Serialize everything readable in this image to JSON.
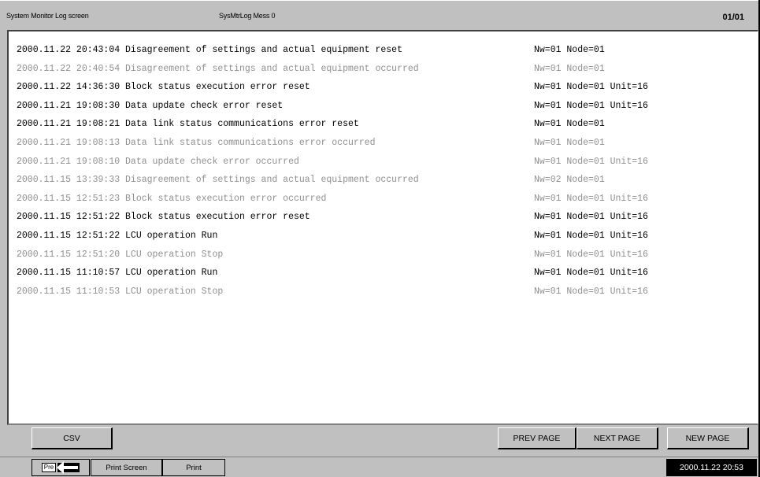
{
  "header": {
    "title": "System Monitor Log screen",
    "subtitle": "SysMtrLog Mess 0",
    "page": "01/01"
  },
  "log": [
    {
      "datetime": "2000.11.22 20:43:04",
      "message": "Disagreement of settings and actual equipment reset",
      "location": "Nw=01 Node=01",
      "state": "active"
    },
    {
      "datetime": "2000.11.22 20:40:54",
      "message": "Disagreement of settings and actual equipment occurred",
      "location": "Nw=01 Node=01",
      "state": "inactive"
    },
    {
      "datetime": "2000.11.22 14:36:30",
      "message": "Block status execution error reset",
      "location": "Nw=01 Node=01 Unit=16",
      "state": "active"
    },
    {
      "datetime": "2000.11.21 19:08:30",
      "message": "Data update check error reset",
      "location": "Nw=01 Node=01 Unit=16",
      "state": "active"
    },
    {
      "datetime": "2000.11.21 19:08:21",
      "message": "Data link status communications error reset",
      "location": "Nw=01 Node=01",
      "state": "active"
    },
    {
      "datetime": "2000.11.21 19:08:13",
      "message": "Data link status communications error occurred",
      "location": "Nw=01 Node=01",
      "state": "inactive"
    },
    {
      "datetime": "2000.11.21 19:08:10",
      "message": "Data update check error occurred",
      "location": "Nw=01 Node=01 Unit=16",
      "state": "inactive"
    },
    {
      "datetime": "2000.11.15 13:39:33",
      "message": "Disagreement of settings and actual equipment occurred",
      "location": "Nw=02 Node=01",
      "state": "inactive"
    },
    {
      "datetime": "2000.11.15 12:51:23",
      "message": "Block status execution error occurred",
      "location": "Nw=01 Node=01 Unit=16",
      "state": "inactive"
    },
    {
      "datetime": "2000.11.15 12:51:22",
      "message": "Block status execution error reset",
      "location": "Nw=01 Node=01 Unit=16",
      "state": "active"
    },
    {
      "datetime": "2000.11.15 12:51:22",
      "message": "LCU operation Run",
      "location": "Nw=01 Node=01 Unit=16",
      "state": "active"
    },
    {
      "datetime": "2000.11.15 12:51:20",
      "message": "LCU operation Stop",
      "location": "Nw=01 Node=01 Unit=16",
      "state": "inactive"
    },
    {
      "datetime": "2000.11.15 11:10:57",
      "message": "LCU operation Run",
      "location": "Nw=01 Node=01 Unit=16",
      "state": "active"
    },
    {
      "datetime": "2000.11.15 11:10:53",
      "message": "LCU operation Stop",
      "location": "Nw=01 Node=01 Unit=16",
      "state": "inactive"
    }
  ],
  "toolbar": {
    "csv_label": "CSV",
    "prev_label": "PREV PAGE",
    "next_label": "NEXT PAGE",
    "new_label": "NEW PAGE"
  },
  "statusbar": {
    "pre_label": "Pre",
    "pre_icon": "back-arrow-icon",
    "print_screen_label": "Print Screen",
    "print_label": "Print",
    "clock": "2000.11.22 20:53"
  },
  "colors": {
    "active_text": "#000000",
    "inactive_text": "#909090",
    "panel_bg": "#c0c0c0",
    "clock_bg": "#000000"
  }
}
